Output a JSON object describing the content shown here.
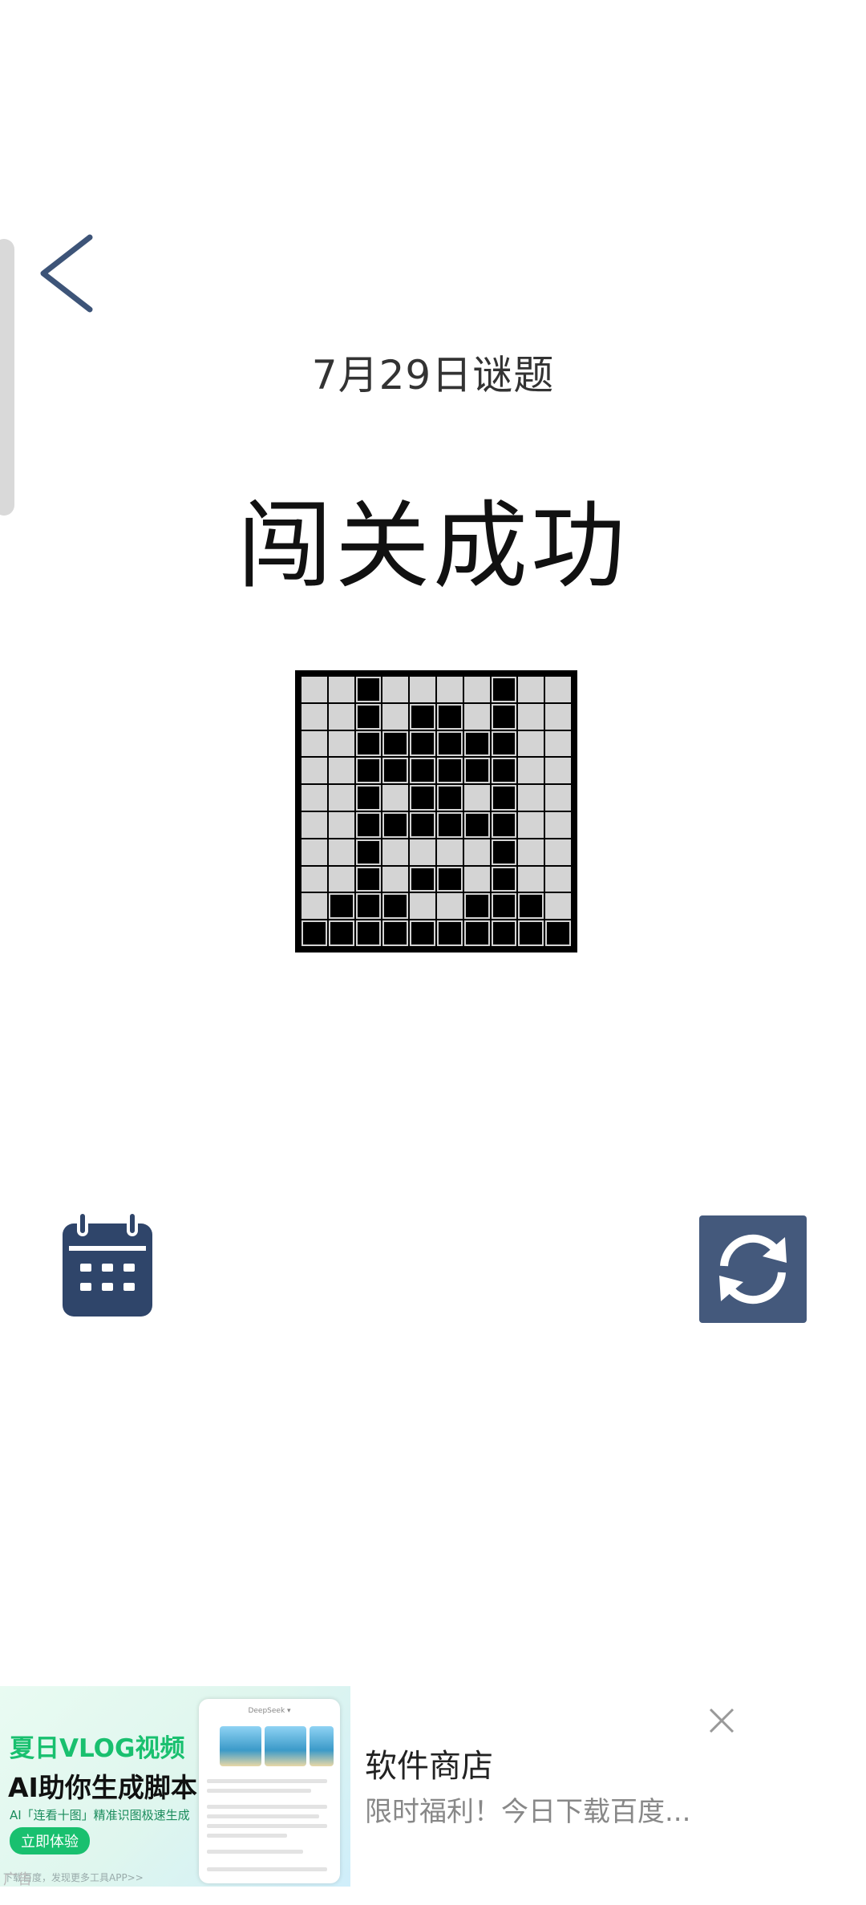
{
  "header": {
    "back_icon": "chevron-left-icon",
    "date_title": "7月29日谜题",
    "status": "闯关成功"
  },
  "puzzle": {
    "rows": 10,
    "cols": 10,
    "grid": [
      [
        0,
        0,
        1,
        0,
        0,
        0,
        0,
        1,
        0,
        0
      ],
      [
        0,
        0,
        1,
        0,
        1,
        1,
        0,
        1,
        0,
        0
      ],
      [
        0,
        0,
        1,
        1,
        1,
        1,
        1,
        1,
        0,
        0
      ],
      [
        0,
        0,
        1,
        1,
        1,
        1,
        1,
        1,
        0,
        0
      ],
      [
        0,
        0,
        1,
        0,
        1,
        1,
        0,
        1,
        0,
        0
      ],
      [
        0,
        0,
        1,
        1,
        1,
        1,
        1,
        1,
        0,
        0
      ],
      [
        0,
        0,
        1,
        0,
        0,
        0,
        0,
        1,
        0,
        0
      ],
      [
        0,
        0,
        1,
        0,
        1,
        1,
        0,
        1,
        0,
        0
      ],
      [
        0,
        1,
        1,
        1,
        0,
        0,
        1,
        1,
        1,
        0
      ],
      [
        1,
        1,
        1,
        1,
        1,
        1,
        1,
        1,
        1,
        1
      ]
    ],
    "colors": {
      "filled": "#000000",
      "empty": "#d4d4d4"
    }
  },
  "actions": {
    "calendar_icon": "calendar-icon",
    "refresh_icon": "refresh-icon",
    "accent": "#44597c"
  },
  "ad": {
    "image_headline": "夏日VLOG视频",
    "image_sub": "AI助你生成脚本",
    "image_tagline": "AI「连看十图」精准识图极速生成",
    "image_cta": "立即体验",
    "image_phone_title": "DeepSeek ▾",
    "image_foot": "下载百度，发现更多工具APP>>",
    "label": "广告",
    "title": "软件商店",
    "description": "限时福利！今日下载百度...",
    "close_icon": "close-icon"
  }
}
